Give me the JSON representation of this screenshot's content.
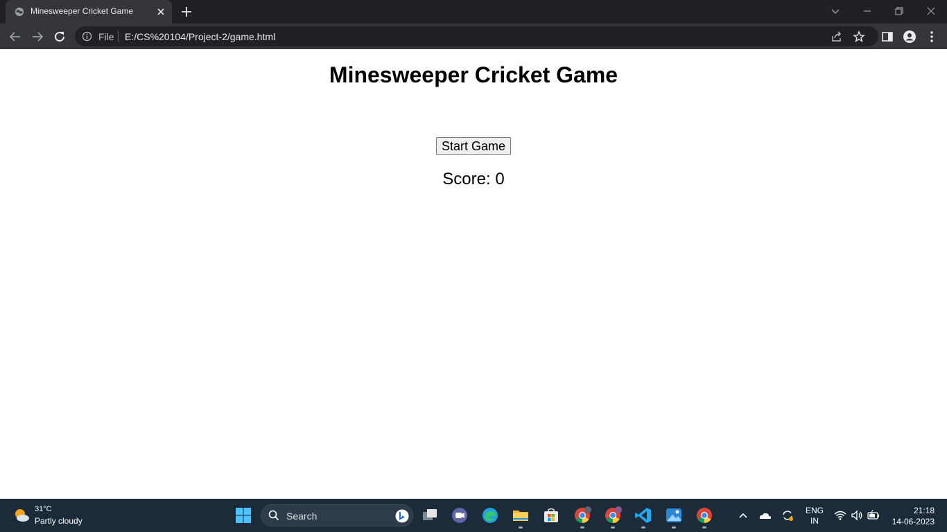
{
  "browser": {
    "tab_title": "Minesweeper Cricket Game",
    "scheme_label": "File",
    "url": "E:/CS%20104/Project-2/game.html"
  },
  "page": {
    "heading": "Minesweeper Cricket Game",
    "start_button": "Start Game",
    "score_label": "Score: 0"
  },
  "taskbar": {
    "weather": {
      "temperature": "31°C",
      "condition": "Partly cloudy"
    },
    "search_label": "Search",
    "language": {
      "code": "ENG",
      "region": "IN"
    },
    "clock": {
      "time": "21:18",
      "date": "14-06-2023"
    }
  }
}
